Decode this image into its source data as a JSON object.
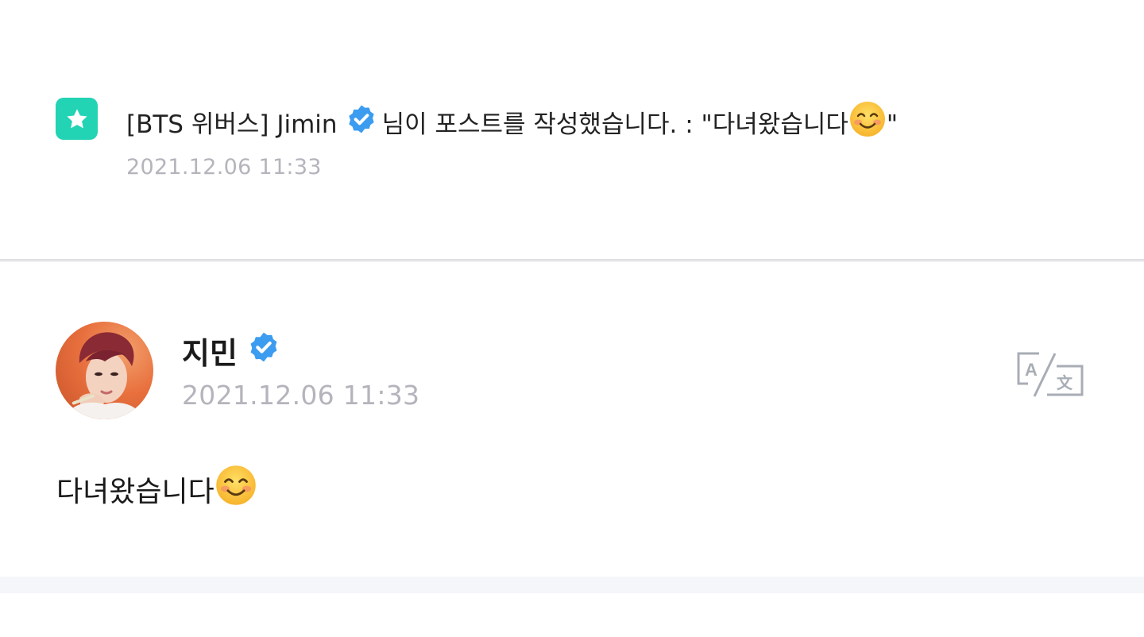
{
  "notification": {
    "icon": "star-icon",
    "prefix": "[BTS 위버스] Jimin",
    "suffix": "님이 포스트를 작성했습니다. : \"다녀왔습니다",
    "end_quote": "\"",
    "timestamp": "2021.12.06 11:33"
  },
  "post": {
    "author": "지민",
    "timestamp": "2021.12.06 11:33",
    "body": "다녀왔습니다",
    "translate_icon": "translate-icon"
  },
  "colors": {
    "accent": "#22d3b4",
    "verified": "#3b9cf0",
    "muted_text": "#b4b4bc"
  }
}
